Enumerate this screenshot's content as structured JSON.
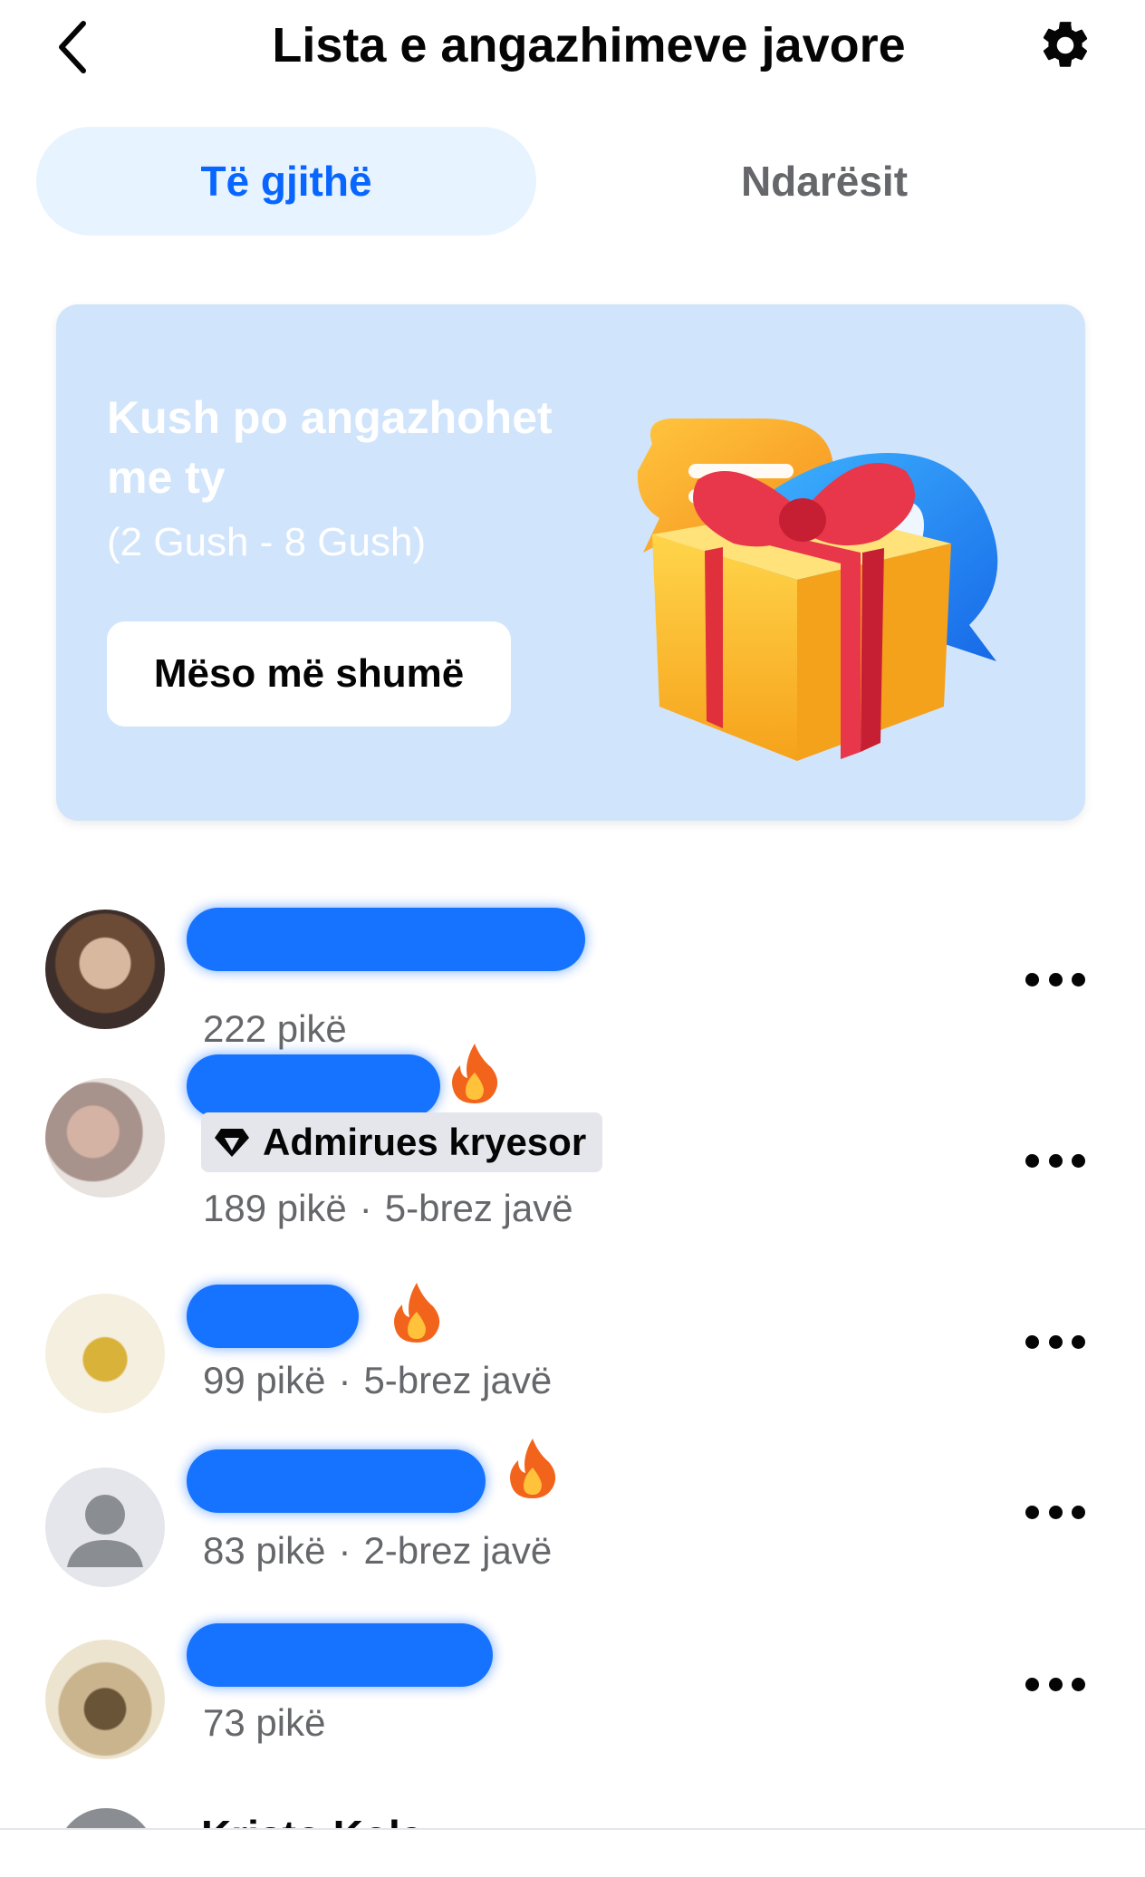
{
  "header": {
    "title": "Lista e angazhimeve javore",
    "back_icon": "chevron-left-icon",
    "settings_icon": "gear-icon"
  },
  "tabs": [
    {
      "label": "Të gjithë",
      "selected": true
    },
    {
      "label": "Ndarësit",
      "selected": false
    }
  ],
  "promo": {
    "title": "Kush po angazhohet me ty",
    "subtitle": "(2 Gush - 8 Gush)",
    "button_label": "Mëso më shumë",
    "illustration": [
      "chat-bubble-icon",
      "heart-bubble-icon",
      "gift-box-icon"
    ]
  },
  "members": [
    {
      "points": "222 pikë",
      "streak": "",
      "badge": "",
      "fire": false
    },
    {
      "points": "189 pikë",
      "streak": "5-brez javë",
      "badge": "Admirues kryesor",
      "fire": true
    },
    {
      "points": "99 pikë",
      "streak": "5-brez javë",
      "badge": "",
      "fire": true
    },
    {
      "points": "83 pikë",
      "streak": "2-brez javë",
      "badge": "",
      "fire": true
    },
    {
      "points": "73 pikë",
      "streak": "",
      "badge": "",
      "fire": false
    }
  ],
  "next_member": {
    "name": "Kristo Kola"
  },
  "colors": {
    "accent": "#0866ff",
    "tab_selected_bg": "#e7f3ff",
    "promo_bg": "#d0e4fb",
    "scribble": "#0a6cff",
    "secondary_text": "#65676b"
  }
}
